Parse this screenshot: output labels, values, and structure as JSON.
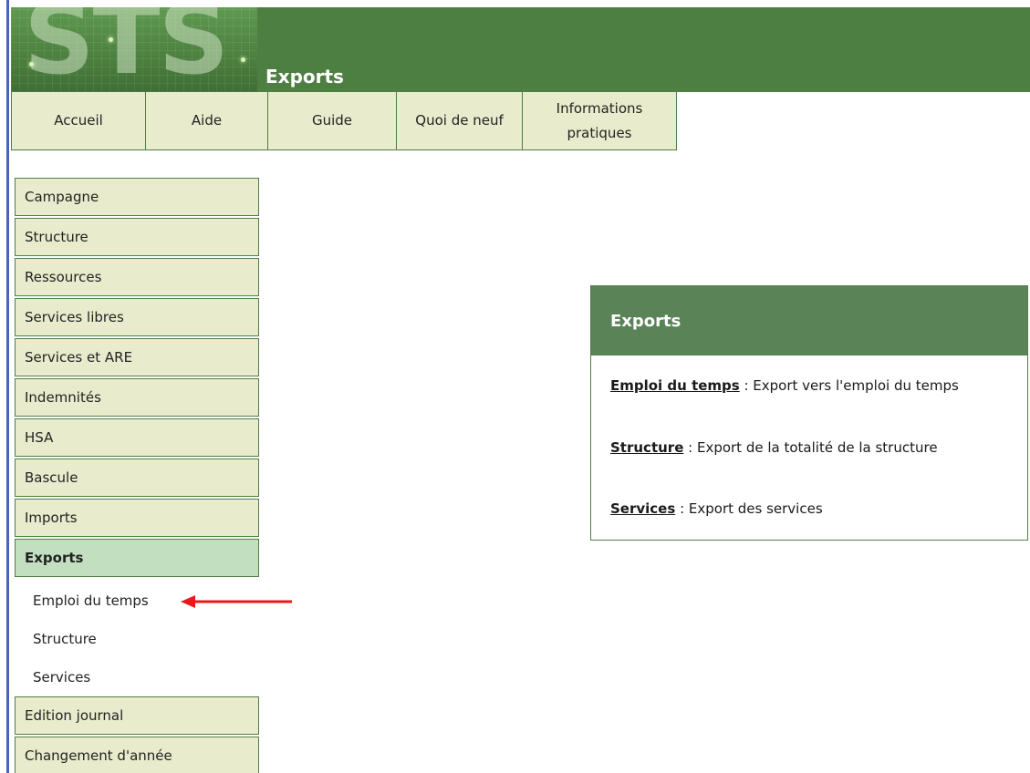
{
  "logo": {
    "text": "STS"
  },
  "page_title": "Exports",
  "topnav": {
    "items": [
      {
        "label": "Accueil"
      },
      {
        "label": "Aide"
      },
      {
        "label": "Guide"
      },
      {
        "label": "Quoi de neuf"
      },
      {
        "label": "Informations\npratiques"
      }
    ]
  },
  "sidebar": {
    "items": [
      {
        "label": "Campagne"
      },
      {
        "label": "Structure"
      },
      {
        "label": "Ressources"
      },
      {
        "label": "Services libres"
      },
      {
        "label": "Services et ARE"
      },
      {
        "label": "Indemnités"
      },
      {
        "label": "HSA"
      },
      {
        "label": "Bascule"
      },
      {
        "label": "Imports"
      },
      {
        "label": "Exports",
        "active": true
      },
      {
        "label": "Edition journal"
      },
      {
        "label": "Changement d'année"
      }
    ],
    "exports_subitems": [
      {
        "label": "Emploi du temps"
      },
      {
        "label": "Structure"
      },
      {
        "label": "Services"
      }
    ]
  },
  "panel": {
    "title": "Exports",
    "rows": [
      {
        "link": "Emploi du temps",
        "text": " : Export vers l'emploi du temps"
      },
      {
        "link": "Structure",
        "text": " : Export de la totalité de la structure"
      },
      {
        "link": "Services",
        "text": " : Export des services"
      }
    ]
  },
  "colors": {
    "banner": "#4e7f42",
    "nav_bg": "#e8eccc",
    "active_bg": "#c2e0c0",
    "panel_header": "#5a8357",
    "arrow": "#e8191c"
  }
}
